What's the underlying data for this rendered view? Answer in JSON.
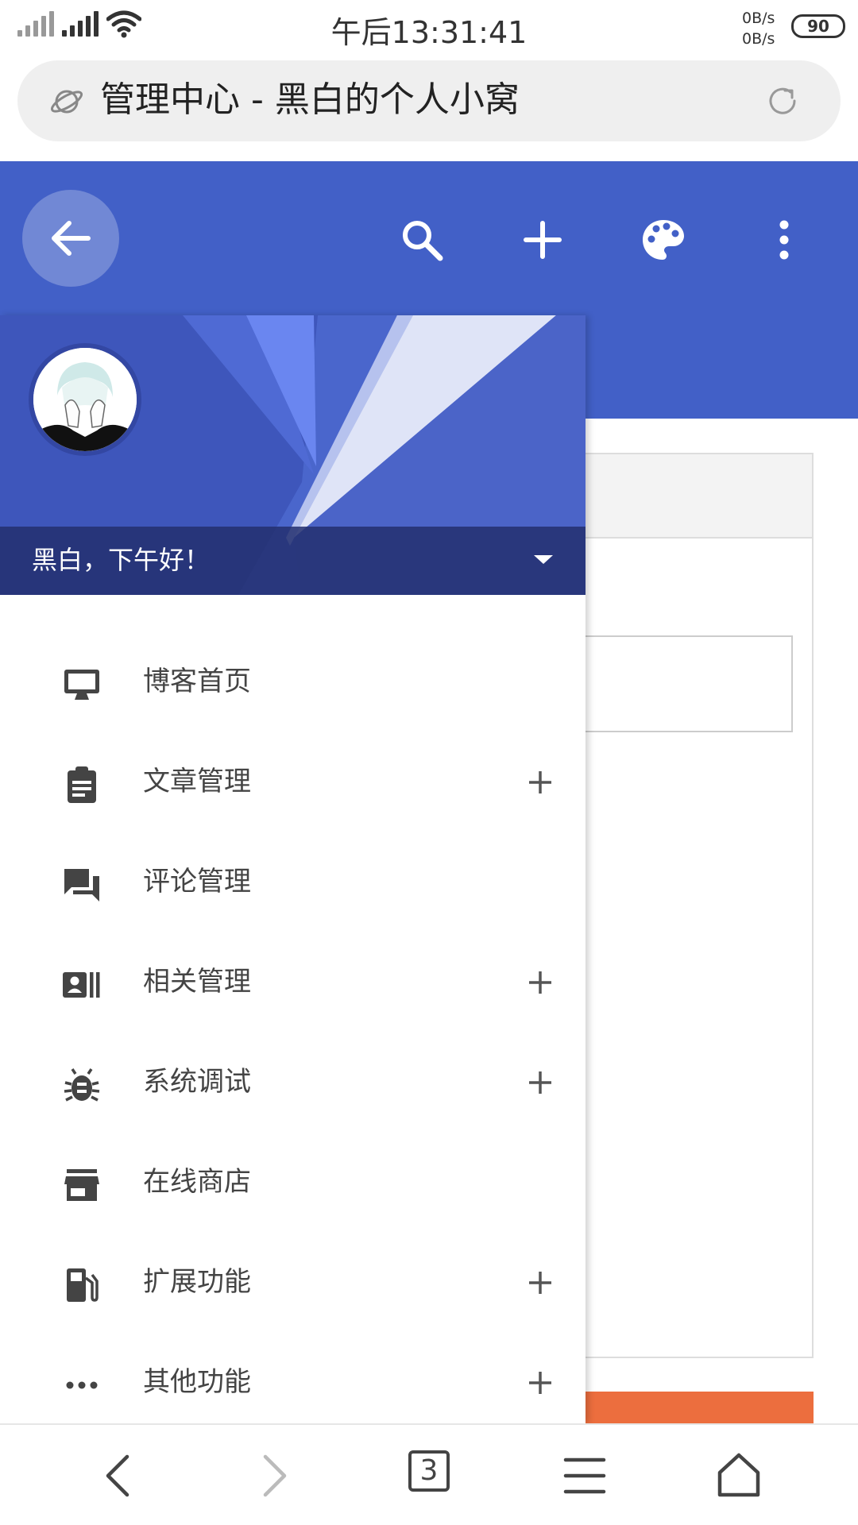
{
  "status_bar": {
    "time": "午后13:31:41",
    "net_up": "0B/s",
    "net_down": "0B/s",
    "battery": "90"
  },
  "browser": {
    "page_title": "管理中心 - 黑白的个人小窝",
    "tab_count": "3"
  },
  "app_bar": {
    "accent": "#4260c7",
    "icons": [
      "back-arrow-icon",
      "search-icon",
      "add-icon",
      "palette-icon",
      "more-vert-icon"
    ]
  },
  "drawer": {
    "greeting": "黑白，下午好！",
    "items": [
      {
        "label": "博客首页",
        "icon": "desktop-icon",
        "expandable": false
      },
      {
        "label": "文章管理",
        "icon": "clipboard-icon",
        "expandable": true
      },
      {
        "label": "评论管理",
        "icon": "forum-icon",
        "expandable": false
      },
      {
        "label": "相关管理",
        "icon": "contacts-card-icon",
        "expandable": true
      },
      {
        "label": "系统调试",
        "icon": "bug-icon",
        "expandable": true
      },
      {
        "label": "在线商店",
        "icon": "store-icon",
        "expandable": false
      },
      {
        "label": "扩展功能",
        "icon": "fuel-icon",
        "expandable": true
      },
      {
        "label": "其他功能",
        "icon": "more-horiz-icon",
        "expandable": true
      }
    ]
  },
  "colors": {
    "header_blue": "#4260c7",
    "orange_button": "#ec6e3e"
  }
}
